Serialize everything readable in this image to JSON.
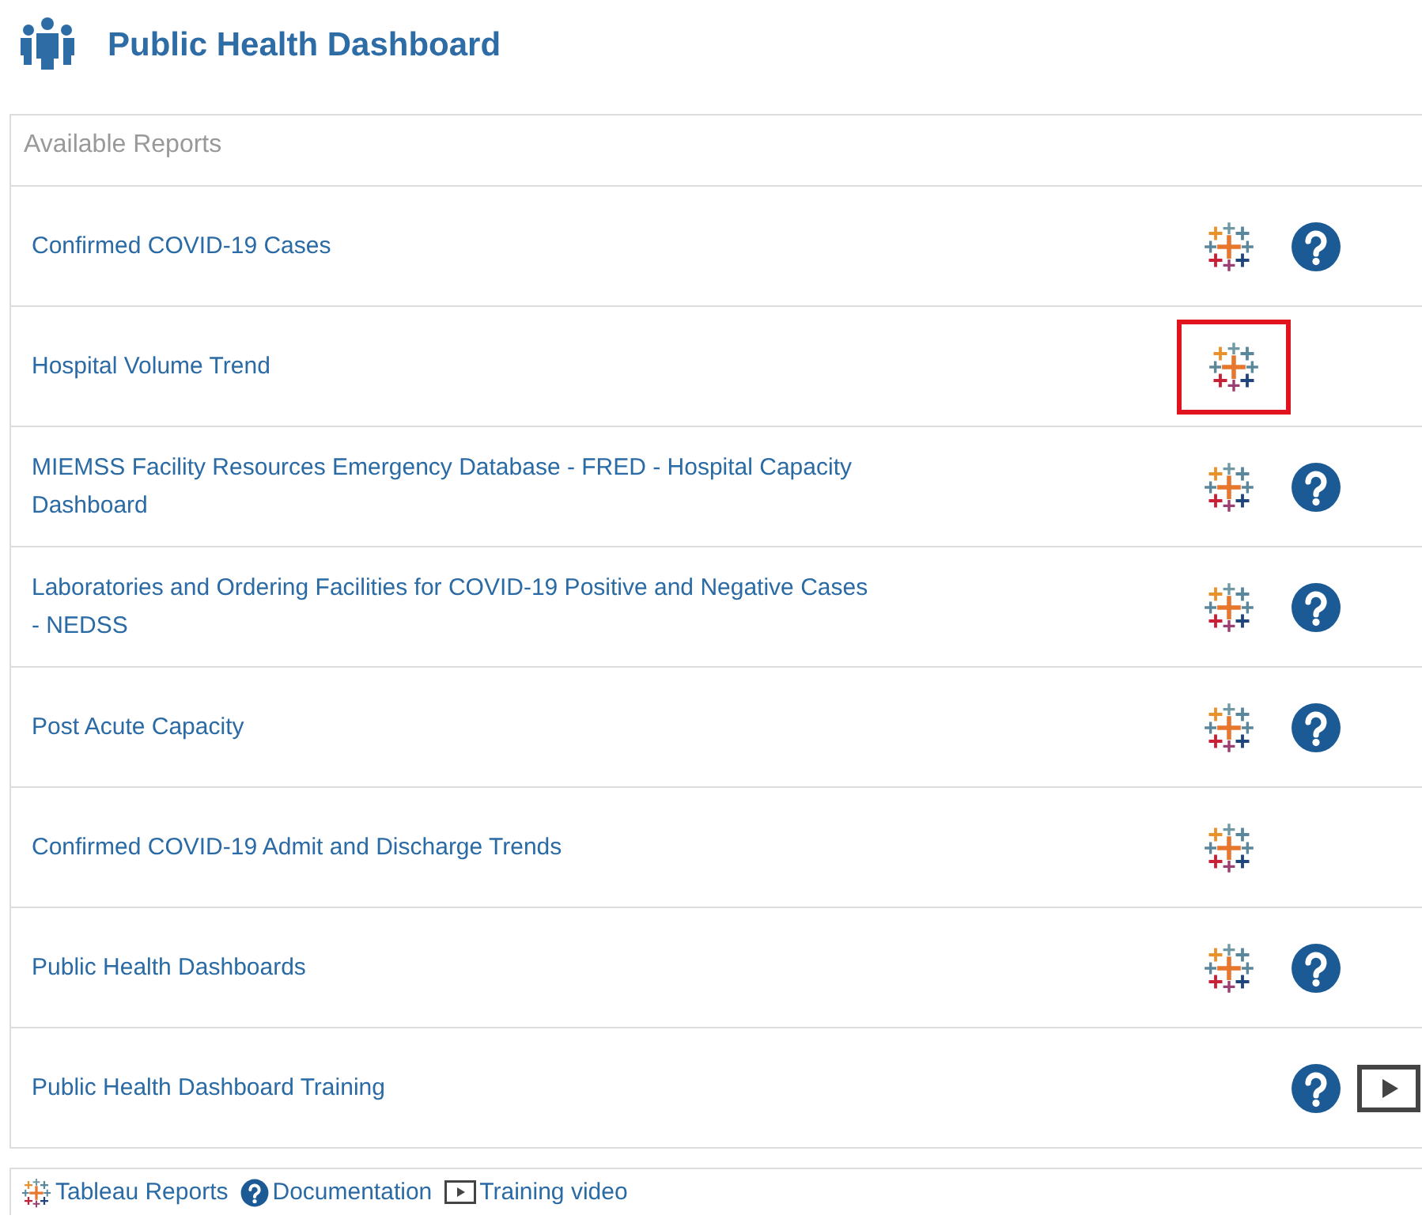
{
  "header": {
    "title": "Public Health Dashboard"
  },
  "panel": {
    "heading": "Available Reports",
    "rows": [
      {
        "title": "Confirmed COVID-19 Cases",
        "icons": [
          {
            "kind": "tableau",
            "highlighted": false
          },
          {
            "kind": "help",
            "highlighted": false
          }
        ]
      },
      {
        "title": "Hospital Volume Trend",
        "icons": [
          {
            "kind": "tableau",
            "highlighted": true
          }
        ]
      },
      {
        "title": "MIEMSS Facility Resources Emergency Database - FRED - Hospital Capacity Dashboard",
        "icons": [
          {
            "kind": "tableau",
            "highlighted": false
          },
          {
            "kind": "help",
            "highlighted": false
          }
        ]
      },
      {
        "title": "Laboratories and Ordering Facilities for COVID-19 Positive and Negative Cases - NEDSS",
        "icons": [
          {
            "kind": "tableau",
            "highlighted": false
          },
          {
            "kind": "help",
            "highlighted": false
          }
        ]
      },
      {
        "title": "Post Acute Capacity",
        "icons": [
          {
            "kind": "tableau",
            "highlighted": false
          },
          {
            "kind": "help",
            "highlighted": false
          }
        ]
      },
      {
        "title": "Confirmed COVID-19 Admit and Discharge Trends",
        "icons": [
          {
            "kind": "tableau",
            "highlighted": false
          }
        ]
      },
      {
        "title": "Public Health Dashboards",
        "icons": [
          {
            "kind": "tableau",
            "highlighted": false
          },
          {
            "kind": "help",
            "highlighted": false
          }
        ]
      },
      {
        "title": "Public Health Dashboard Training",
        "icons": [
          {
            "kind": "help",
            "highlighted": false
          },
          {
            "kind": "video",
            "highlighted": false
          }
        ]
      }
    ]
  },
  "legend": [
    {
      "kind": "tableau",
      "label": "Tableau Reports"
    },
    {
      "kind": "help",
      "label": "Documentation"
    },
    {
      "kind": "video",
      "label": "Training video"
    }
  ]
}
